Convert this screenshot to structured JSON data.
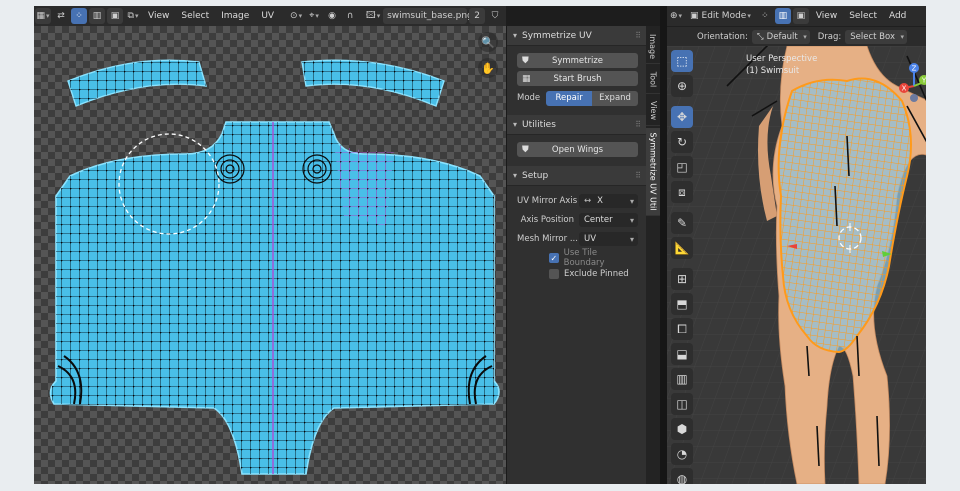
{
  "uv_editor": {
    "menus": [
      "View",
      "Select",
      "Image",
      "UV"
    ],
    "image_name": "swimsuit_base.png",
    "user_count": "2"
  },
  "sidebar": {
    "tabs": [
      "Image",
      "Tool",
      "View",
      "Symmetrize UV Util"
    ],
    "symmetrize_panel": {
      "title": "Symmetrize UV",
      "symmetrize_label": "Symmetrize",
      "start_brush_label": "Start Brush",
      "mode_label": "Mode",
      "mode_options": [
        "Repair",
        "Expand"
      ],
      "mode_selected": "Repair"
    },
    "utilities_panel": {
      "title": "Utilities",
      "open_wings_label": "Open Wings"
    },
    "setup_panel": {
      "title": "Setup",
      "uv_mirror_axis_label": "UV Mirror Axis",
      "uv_mirror_axis_value": "X",
      "axis_position_label": "Axis Position",
      "axis_position_value": "Center",
      "mesh_mirror_label": "Mesh Mirror ...",
      "mesh_mirror_value": "UV",
      "use_tile_boundary_label": "Use Tile Boundary",
      "use_tile_boundary_checked": true,
      "exclude_pinned_label": "Exclude Pinned",
      "exclude_pinned_checked": false
    }
  },
  "viewport": {
    "mode": "Edit Mode",
    "menus": [
      "View",
      "Select",
      "Add"
    ],
    "orientation_label": "Orientation:",
    "orientation_value": "Default",
    "drag_label": "Drag:",
    "drag_value": "Select Box",
    "perspective_text": "User Perspective",
    "object_text": "(1) Swimsuit",
    "gizmo_axes": [
      "X",
      "Y",
      "Z"
    ],
    "tools": [
      "select-box-tool",
      "cursor-tool",
      "move-tool",
      "rotate-tool",
      "scale-tool",
      "transform-tool",
      "annotate-tool",
      "measure-tool",
      "add-cube-tool",
      "extrude-tool",
      "inset-tool",
      "bevel-tool",
      "loop-cut-tool",
      "knife-tool",
      "poly-build-tool",
      "spin-tool",
      "smooth-tool"
    ]
  },
  "colors": {
    "uv_island": "#49bfe8",
    "uv_outline": "#8be3ff",
    "selection_purple": "#b04bd6",
    "mesh_orange": "#ff9a1a",
    "skin": "#e6b085",
    "active_blue": "#4772b3"
  }
}
